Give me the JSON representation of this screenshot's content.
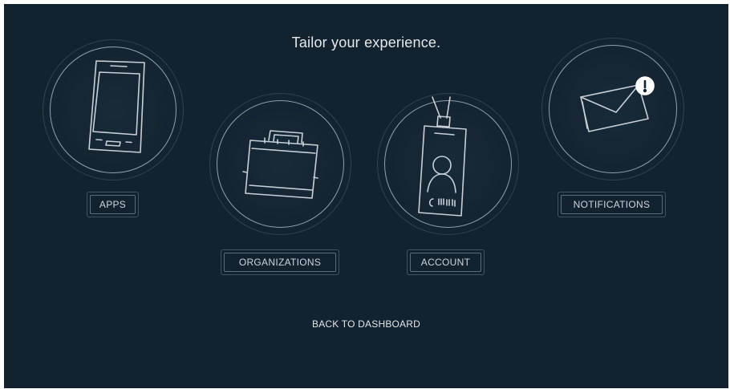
{
  "header": {
    "title": "Tailor your experience."
  },
  "options": {
    "apps": {
      "label": "APPS",
      "icon": "smartphone-icon"
    },
    "organizations": {
      "label": "ORGANIZATIONS",
      "icon": "briefcase-icon"
    },
    "account": {
      "label": "ACCOUNT",
      "icon": "id-badge-icon"
    },
    "notifications": {
      "label": "NOTIFICATIONS",
      "icon": "envelope-alert-icon"
    }
  },
  "footer": {
    "back_label": "BACK TO DASHBOARD"
  },
  "colors": {
    "background": "#13222f",
    "line": "#8fa1b0",
    "text": "#e4e9ee"
  }
}
